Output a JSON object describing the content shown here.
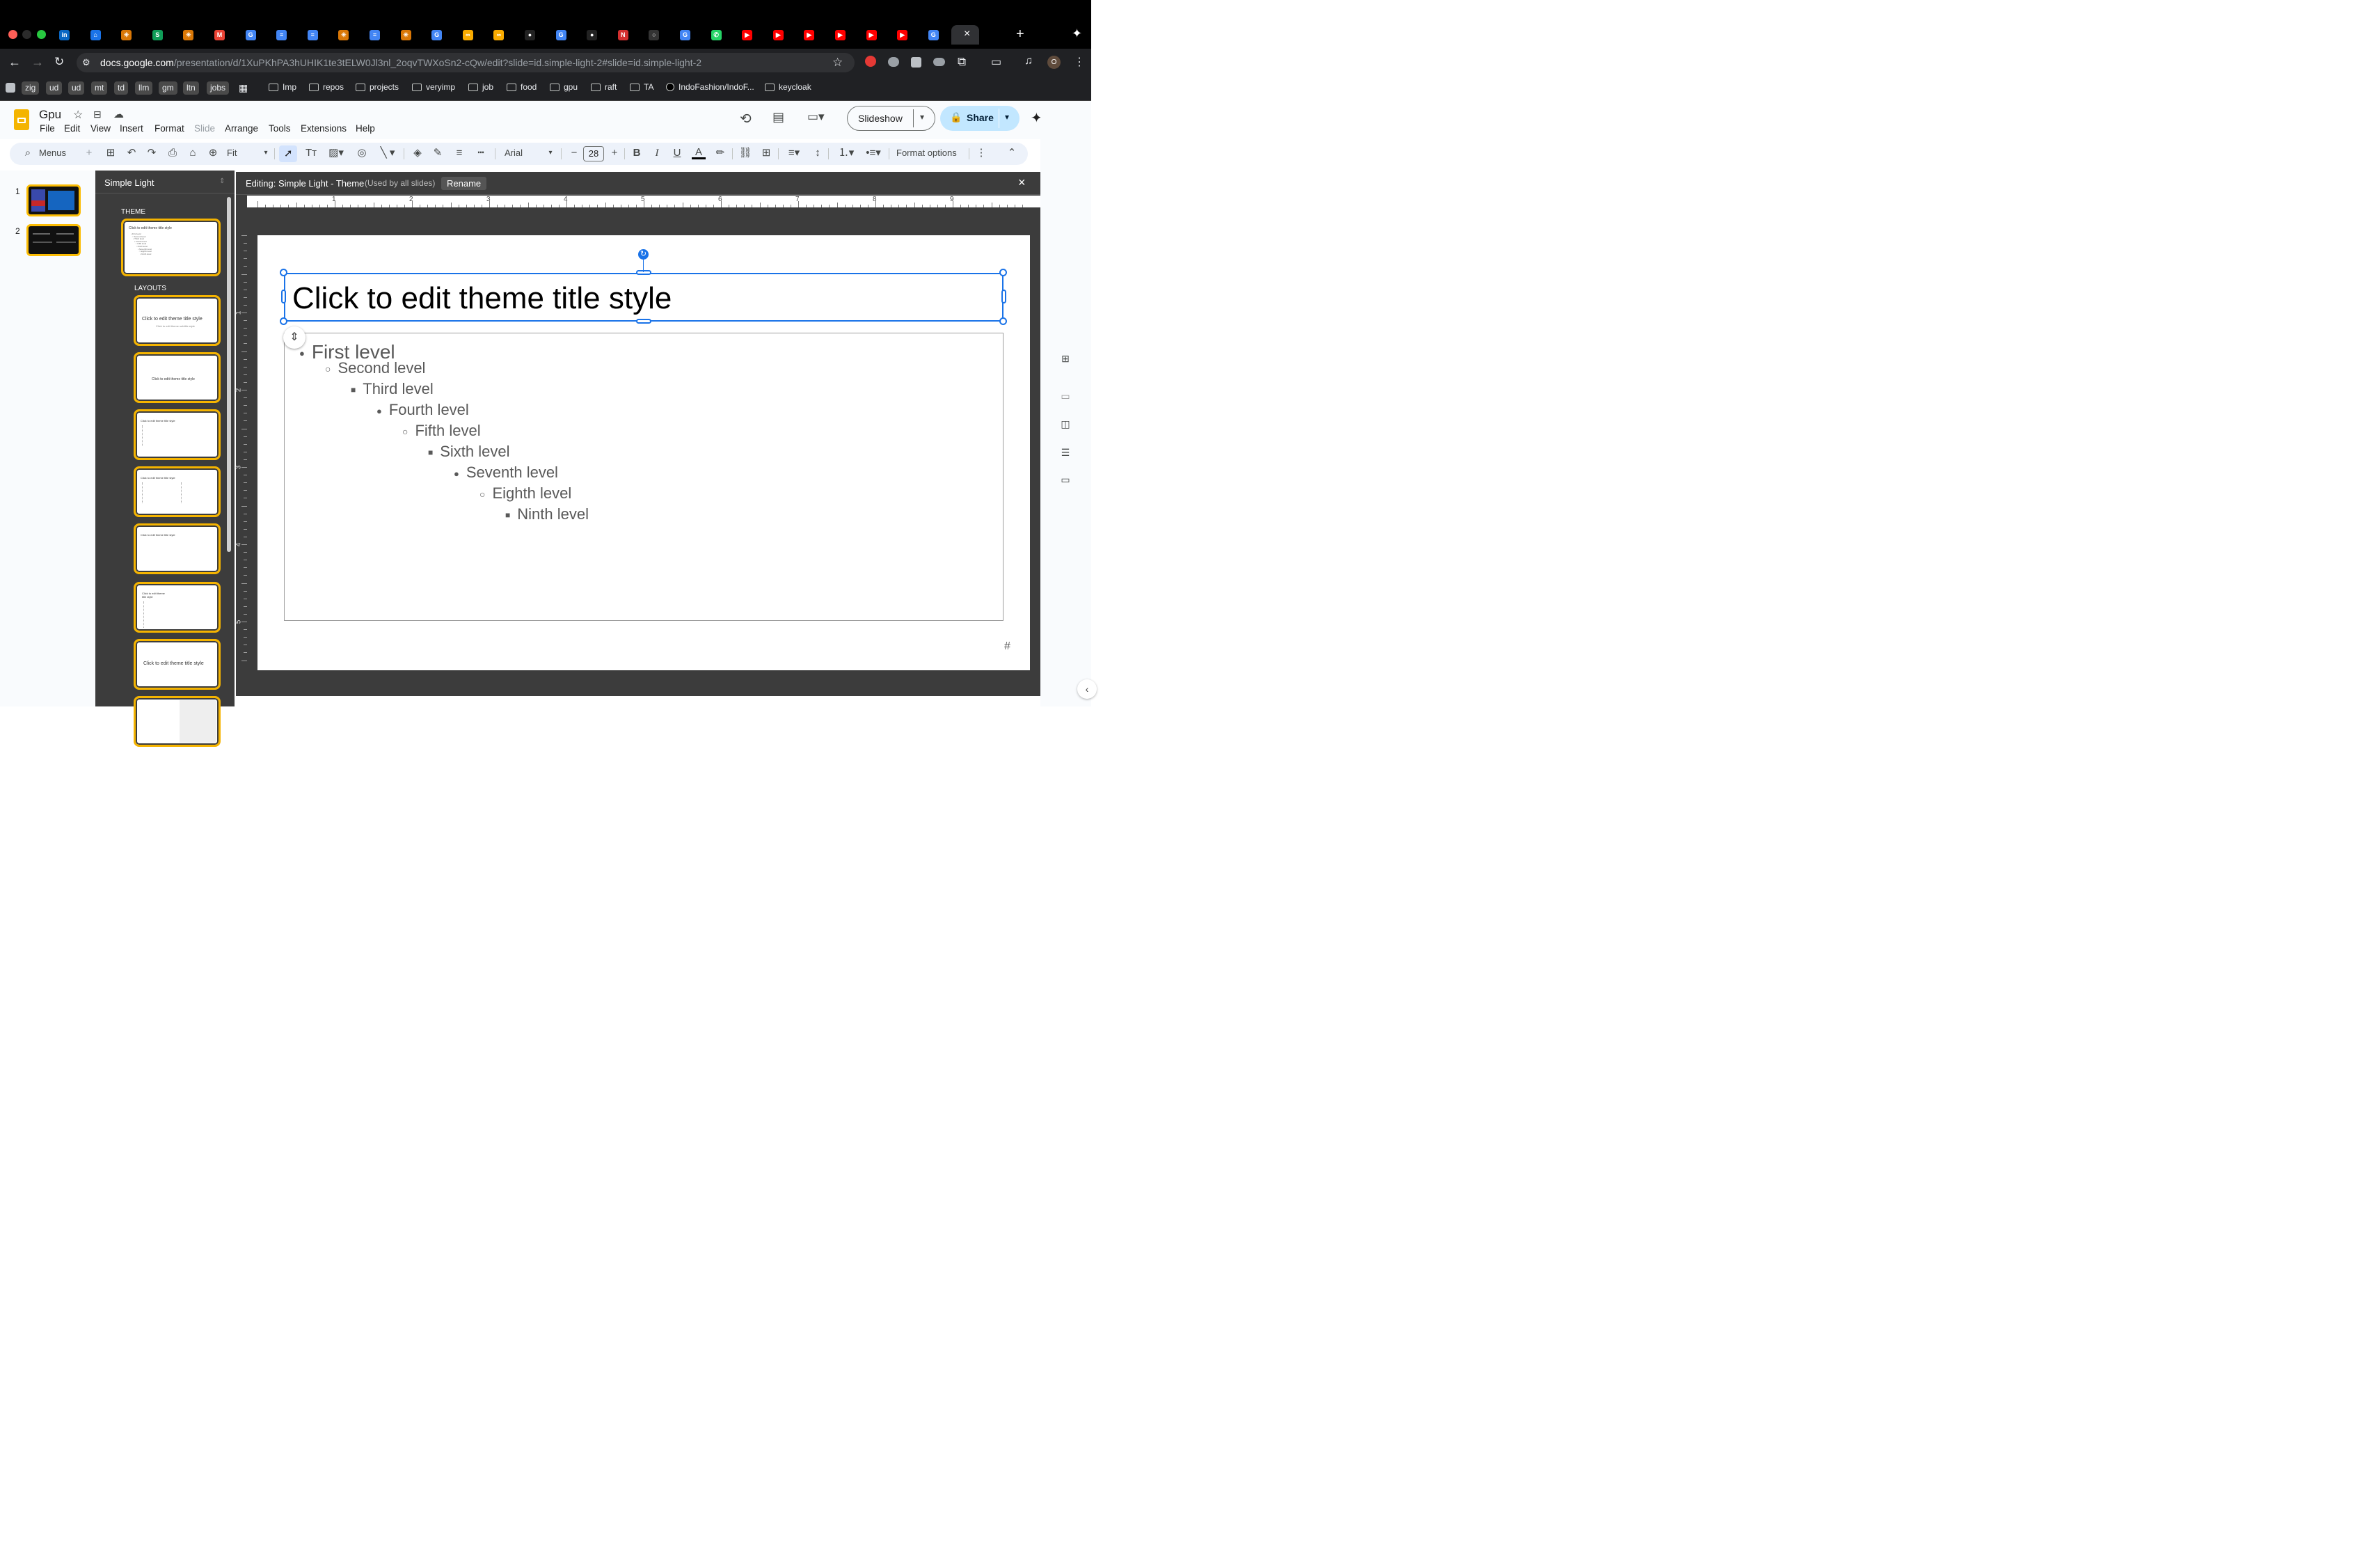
{
  "browser": {
    "tabs": [
      "in",
      "⌂",
      "✳",
      "S",
      "✳",
      "M",
      "G",
      "≡",
      "≡",
      "✳",
      "≡",
      "✳",
      "G",
      "∞",
      "∞",
      "●",
      "G",
      "●",
      "N",
      "○",
      "G",
      "✆",
      "▶",
      "▶",
      "▶",
      "▶",
      "▶",
      "▶",
      "G",
      "×"
    ],
    "url_domain": "docs.google.com",
    "url_path": "/presentation/d/1XuPKhPA3hUHIK1te3tELW0Jl3nl_2oqvTWXoSn2-cQw/edit?slide=id.simple-light-2#slide=id.simple-light-2",
    "profile": "O"
  },
  "bookmarks": {
    "chips": [
      "zig",
      "ud",
      "ud",
      "mt",
      "td",
      "llm",
      "gm",
      "ltn",
      "jobs"
    ],
    "folders": [
      "Imp",
      "repos",
      "projects",
      "veryimp",
      "job",
      "food",
      "gpu",
      "raft",
      "TA",
      "IndoFashion/IndoF...",
      "keycloak"
    ]
  },
  "app": {
    "doc_title": "Gpu",
    "menus": [
      "File",
      "Edit",
      "View",
      "Insert",
      "Format",
      "Slide",
      "Arrange",
      "Tools",
      "Extensions",
      "Help"
    ],
    "slideshow_label": "Slideshow",
    "share_label": "Share",
    "avatar_letter": "O"
  },
  "toolbar": {
    "menus_label": "Menus",
    "zoom": "Fit",
    "font": "Arial",
    "font_size": "28",
    "format_options": "Format options"
  },
  "filmstrip": {
    "numbers": [
      "1",
      "2"
    ]
  },
  "theme_panel": {
    "title": "Simple Light",
    "theme_heading": "THEME",
    "layouts_heading": "LAYOUTS",
    "layout_labels": [
      "Click to edit theme title style",
      "Click to edit theme subtitle style",
      "Click to edit theme title style",
      "Click to edit theme title style",
      "Click to edit theme title style",
      "Click to edit theme title style",
      "Click to edit theme title style"
    ]
  },
  "editor": {
    "banner_label": "Editing: Simple Light - Theme",
    "banner_note": "(Used by all slides)",
    "rename_label": "Rename",
    "ruler_h": [
      "1",
      "2",
      "3",
      "4",
      "5",
      "6",
      "7",
      "8",
      "9"
    ],
    "ruler_v": [
      "1",
      "2",
      "3",
      "4",
      "5"
    ]
  },
  "slide": {
    "title": "Click to edit theme title style",
    "levels": [
      "First level",
      "Second level",
      "Third level",
      "Fourth level",
      "Fifth level",
      "Sixth level",
      "Seventh level",
      "Eighth level",
      "Ninth level"
    ],
    "page_number": "#"
  },
  "colors": {
    "accent": "#1a73e8",
    "highlight": "#fbbc04",
    "panel": "#3c3c3c"
  }
}
